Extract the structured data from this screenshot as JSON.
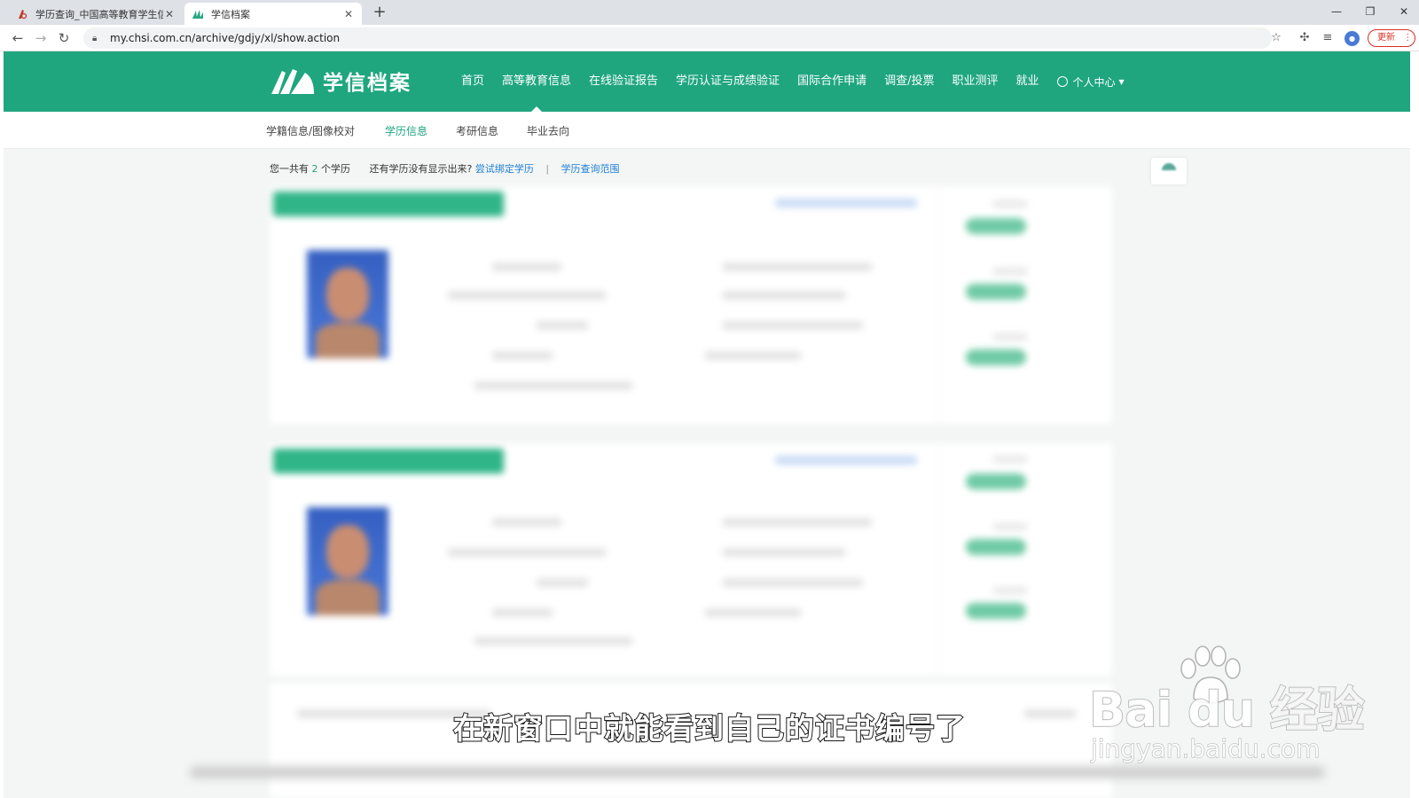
{
  "browser": {
    "tabs": [
      {
        "title": "学历查询_中国高等教育学生信息",
        "active": false
      },
      {
        "title": "学信档案",
        "active": true
      }
    ],
    "new_tab": "+",
    "url": "my.chsi.com.cn/archive/gdjy/xl/show.action",
    "update_label": "更新",
    "window_controls": {
      "minimize": "—",
      "restore": "❐",
      "close": "✕"
    }
  },
  "site": {
    "logo_text": "学信档案",
    "nav": [
      {
        "label": "首页",
        "active": false
      },
      {
        "label": "高等教育信息",
        "active": true
      },
      {
        "label": "在线验证报告",
        "active": false
      },
      {
        "label": "学历认证与成绩验证",
        "active": false
      },
      {
        "label": "国际合作申请",
        "active": false
      },
      {
        "label": "调查/投票",
        "active": false
      },
      {
        "label": "职业测评",
        "active": false
      },
      {
        "label": "就业",
        "active": false
      }
    ],
    "user_center": "个人中心",
    "sub_nav": [
      {
        "label": "学籍信息/图像校对",
        "active": false
      },
      {
        "label": "学历信息",
        "active": true
      },
      {
        "label": "考研信息",
        "active": false
      },
      {
        "label": "毕业去向",
        "active": false
      }
    ],
    "accent_color": "#1fa67f"
  },
  "summary": {
    "prefix": "您一共有",
    "count": "2",
    "suffix": "个学历",
    "question": "还有学历没有显示出来?",
    "bind_link": "尝试绑定学历",
    "separator": "|",
    "scope_link": "学历查询范围"
  },
  "caption": "在新窗口中就能看到自己的证书编号了",
  "watermark": {
    "brand": "Bai  du 经验",
    "url": "jingyan.baidu.com"
  }
}
